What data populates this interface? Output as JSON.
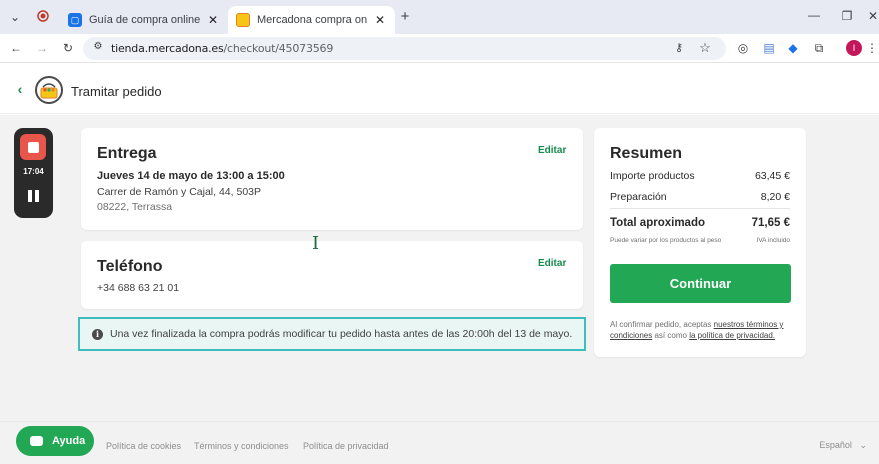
{
  "browser": {
    "tabs": [
      {
        "title": "Guía de compra online en Merc",
        "favicon": "blue-square"
      },
      {
        "title": "Mercadona compra online",
        "favicon": "mercadona-logo"
      }
    ],
    "url_host": "tienda.mercadona.es",
    "url_path": "/checkout/45073569"
  },
  "header": {
    "title": "Tramitar pedido"
  },
  "recorder": {
    "time": "17:04"
  },
  "delivery": {
    "title": "Entrega",
    "edit_label": "Editar",
    "date": "Jueves 14 de mayo de 13:00 a 15:00",
    "address_line1": "Carrer de Ramón y Cajal, 44, 503P",
    "address_line2": "08222, Terrassa"
  },
  "phone": {
    "title": "Teléfono",
    "edit_label": "Editar",
    "number": "+34 688 63 21 01"
  },
  "info": {
    "message": "Una vez finalizada la compra podrás modificar tu pedido hasta antes de las 20:00h del 13 de mayo."
  },
  "summary": {
    "title": "Resumen",
    "products_label": "Importe productos",
    "products_value": "63,45 €",
    "prep_label": "Preparación",
    "prep_value": "8,20 €",
    "total_label": "Total aproximado",
    "total_value": "71,65 €",
    "variance_note": "Puede variar por los productos al peso",
    "vat_note": "IVA incluido",
    "continue_label": "Continuar",
    "legal_prefix": "Al confirmar pedido, aceptas",
    "legal_terms": "nuestros términos y condiciones",
    "legal_mid": "así como",
    "legal_privacy": "la política de privacidad."
  },
  "footer": {
    "help_label": "Ayuda",
    "cookies": "Política de cookies",
    "terms": "Términos y condiciones",
    "privacy": "Política de privacidad",
    "language": "Español"
  },
  "colors": {
    "brand_green": "#22a754",
    "link_green": "#168c4c",
    "info_border": "#3dbdbd",
    "background": "#f2f2f2"
  }
}
